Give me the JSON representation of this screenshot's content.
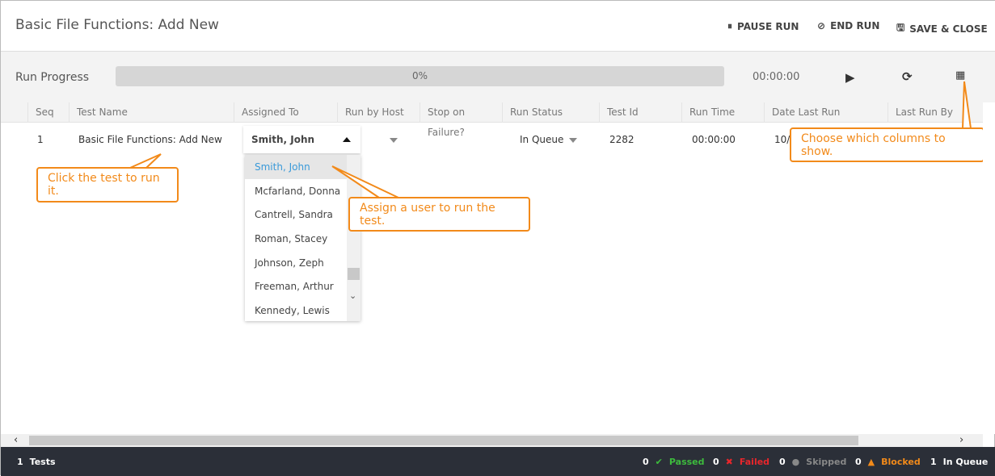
{
  "header": {
    "title": "Basic File Functions: Add New",
    "pause": "PAUSE RUN",
    "end": "END RUN",
    "save": "SAVE & CLOSE"
  },
  "progress": {
    "label": "Run Progress",
    "percent_text": "0%",
    "percent": 0,
    "time": "00:00:00"
  },
  "columns": [
    "Seq",
    "Test Name",
    "Assigned To",
    "Run by Host",
    "Stop on Failure?",
    "Run Status",
    "Test Id",
    "Run Time",
    "Date Last Run",
    "Last Run By"
  ],
  "row": {
    "seq": "1",
    "name": "Basic File Functions: Add New",
    "assigned": "Smith, John",
    "status": "In Queue",
    "test_id": "2282",
    "run_time": "00:00:00",
    "date_last_run": "10/"
  },
  "users": [
    "Smith, John",
    "Mcfarland, Donna",
    "Cantrell, Sandra",
    "Roman, Stacey",
    "Johnson, Zeph",
    "Freeman, Arthur",
    "Kennedy, Lewis"
  ],
  "callouts": {
    "run": "Click the test to run it.",
    "assign": "Assign a user to run the test.",
    "columns": "Choose which columns to show."
  },
  "footer": {
    "tests_count": "1",
    "tests_label": "Tests",
    "passed_count": "0",
    "passed": "Passed",
    "failed_count": "0",
    "failed": "Failed",
    "skipped_count": "0",
    "skipped": "Skipped",
    "blocked_count": "0",
    "blocked": "Blocked",
    "queue_count": "1",
    "queue": "In Queue"
  },
  "colors": {
    "accent": "#f28a1a",
    "passed": "#3dbb3d",
    "failed": "#e8262b",
    "blocked": "#f28a1a",
    "footer": "#2b2f38"
  }
}
